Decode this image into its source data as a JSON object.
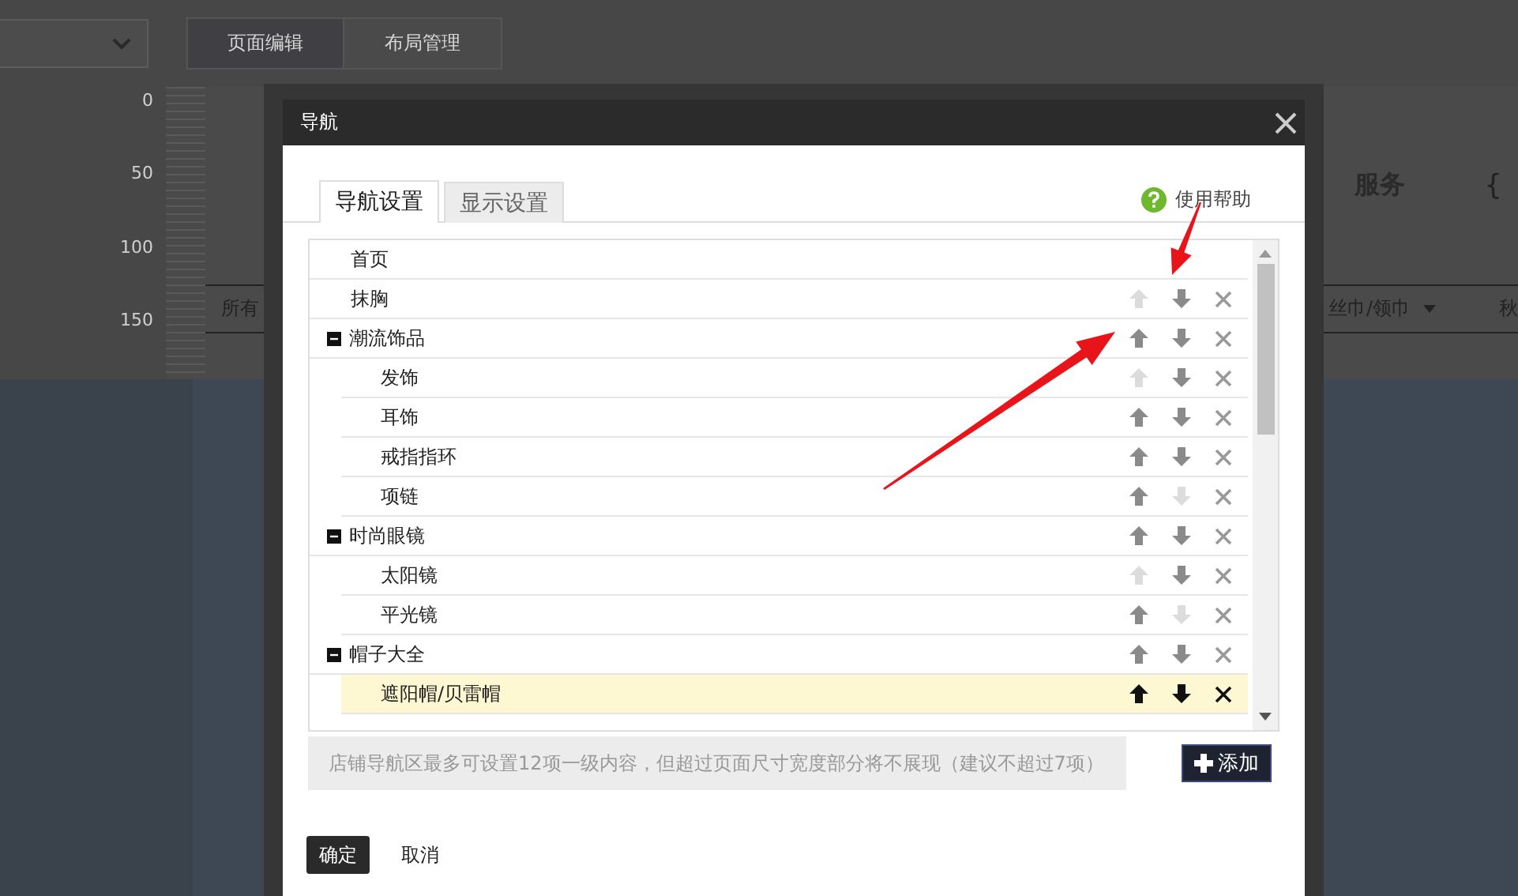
{
  "editor": {
    "view_tabs": [
      {
        "label": "页面编辑",
        "selected": true
      },
      {
        "label": "布局管理",
        "selected": false
      }
    ],
    "ruler_labels": [
      "0",
      "50",
      "100",
      "150"
    ],
    "header_text": "服务",
    "header_symbol": "{",
    "nav_items": [
      {
        "label": "所有",
        "has_menu": false
      },
      {
        "label": "丝巾/领巾",
        "has_menu": true
      },
      {
        "label": "秋",
        "has_menu": false
      }
    ]
  },
  "dialog": {
    "title": "导航",
    "tabs": [
      {
        "label": "导航设置",
        "selected": true
      },
      {
        "label": "显示设置",
        "selected": false
      }
    ],
    "help_link": "使用帮助",
    "rows": [
      {
        "label": "首页",
        "fixed": true,
        "highlighted": false
      },
      {
        "label": "抹胸",
        "fixed": false,
        "up_enabled": false,
        "down_enabled": true,
        "highlighted": false
      },
      {
        "label": "潮流饰品",
        "fixed": false,
        "up_enabled": true,
        "down_enabled": true,
        "highlighted": false,
        "expanded": true,
        "children": [
          {
            "label": "发饰",
            "fixed": false,
            "up_enabled": false,
            "down_enabled": true,
            "highlighted": false
          },
          {
            "label": "耳饰",
            "fixed": false,
            "up_enabled": true,
            "down_enabled": true,
            "highlighted": false
          },
          {
            "label": "戒指指环",
            "fixed": false,
            "up_enabled": true,
            "down_enabled": true,
            "highlighted": false
          },
          {
            "label": "项链",
            "fixed": false,
            "up_enabled": true,
            "down_enabled": false,
            "highlighted": false
          }
        ]
      },
      {
        "label": "时尚眼镜",
        "fixed": false,
        "up_enabled": true,
        "down_enabled": true,
        "highlighted": false,
        "expanded": true,
        "children": [
          {
            "label": "太阳镜",
            "fixed": false,
            "up_enabled": false,
            "down_enabled": true,
            "highlighted": false
          },
          {
            "label": "平光镜",
            "fixed": false,
            "up_enabled": true,
            "down_enabled": false,
            "highlighted": false
          }
        ]
      },
      {
        "label": "帽子大全",
        "fixed": false,
        "up_enabled": true,
        "down_enabled": true,
        "highlighted": false,
        "expanded": true,
        "children": [
          {
            "label": "遮阳帽/贝雷帽",
            "fixed": false,
            "up_enabled": true,
            "down_enabled": true,
            "highlighted": true
          }
        ]
      }
    ],
    "hint": "店铺导航区最多可设置12项一级内容，但超过页面尺寸宽度部分将不展现（建议不超过7项）",
    "add_button": "添加",
    "buttons": [
      {
        "label": "确定",
        "kind": "primary"
      },
      {
        "label": "取消",
        "kind": "plain"
      }
    ]
  }
}
